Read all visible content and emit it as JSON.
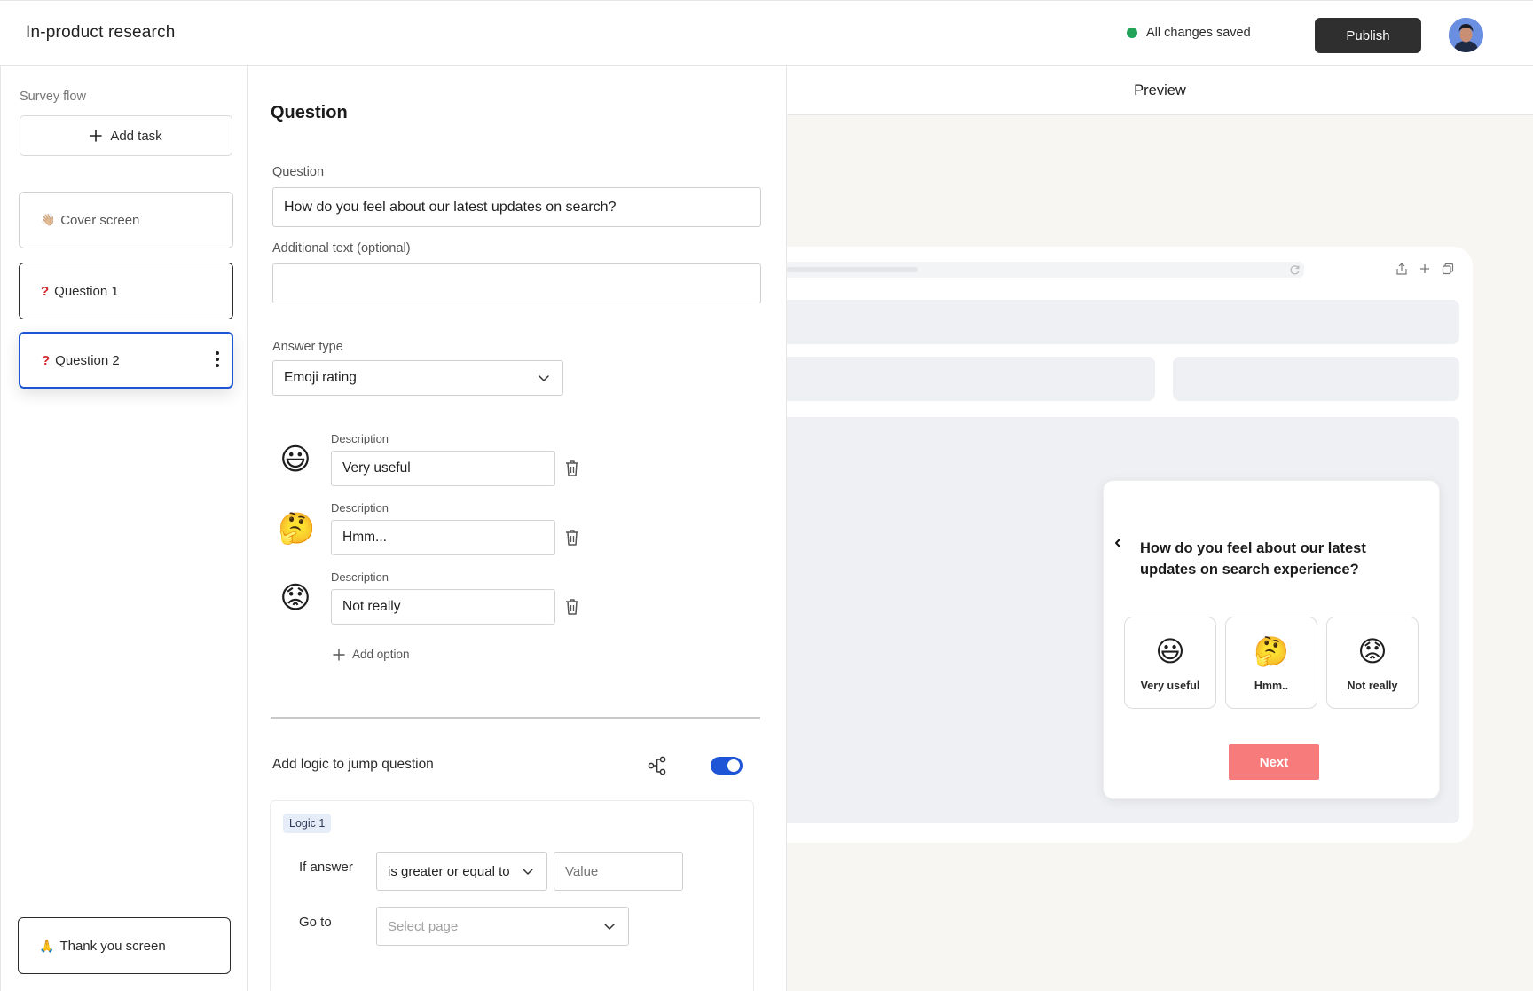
{
  "header": {
    "app_title": "In-product research",
    "save_status": "All changes saved",
    "publish_label": "Publish"
  },
  "sidebar": {
    "heading": "Survey flow",
    "add_task_label": "Add task",
    "items": [
      {
        "emoji": "👋🏼",
        "label": "Cover screen"
      },
      {
        "emoji": "❓",
        "label": "Question 1"
      },
      {
        "emoji": "❓",
        "label": "Question 2"
      }
    ],
    "thanks": {
      "emoji": "🙏",
      "label": "Thank you screen"
    }
  },
  "editor": {
    "title": "Question",
    "question_label": "Question",
    "question_value": "How do you feel about our latest updates on search?",
    "additional_label": "Additional text (optional)",
    "additional_value": "",
    "answer_type_label": "Answer type",
    "answer_type_value": "Emoji rating",
    "options": [
      {
        "emoji": "😃",
        "description_label": "Description",
        "value": "Very useful"
      },
      {
        "emoji": "🤔",
        "description_label": "Description",
        "value": "Hmm..."
      },
      {
        "emoji": "😟",
        "description_label": "Description",
        "value": "Not really"
      }
    ],
    "add_option_label": "Add option",
    "logic_toggle_label": "Add logic to jump question",
    "logic_enabled": true,
    "logic": {
      "tag": "Logic 1",
      "if_answer_label": "If answer",
      "operator_value": "is greater or equal to",
      "value_placeholder": "Value",
      "goto_label": "Go to",
      "goto_placeholder": "Select page"
    }
  },
  "preview": {
    "title": "Preview",
    "survey": {
      "question": "How do you feel about our latest updates on search experience?",
      "choices": [
        {
          "emoji": "😃",
          "label": "Very useful"
        },
        {
          "emoji": "🤔",
          "label": "Hmm.."
        },
        {
          "emoji": "😟",
          "label": "Not really"
        }
      ],
      "next_label": "Next"
    }
  },
  "colors": {
    "accent": "#1d55d6",
    "publish_bg": "#2f2f2f",
    "status_green": "#22a35a",
    "next_button": "#f77b7b"
  }
}
